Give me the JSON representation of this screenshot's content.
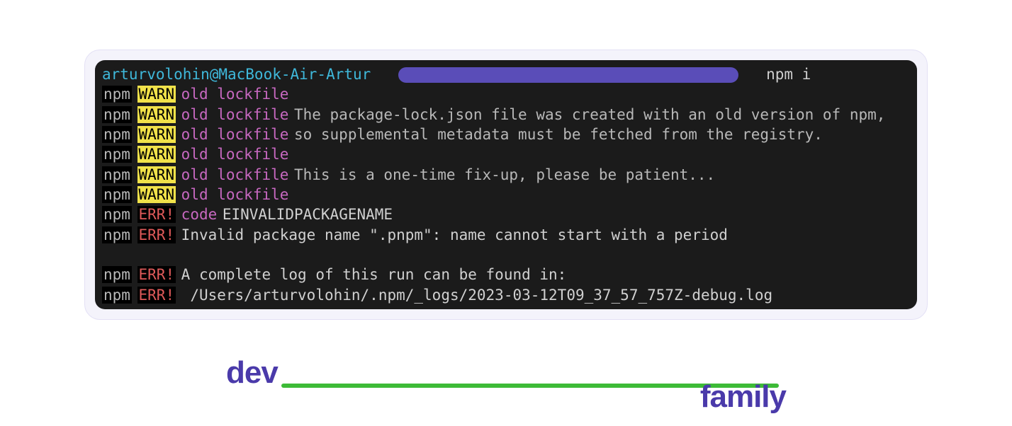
{
  "colors": {
    "terminal_bg": "#1b1b1b",
    "frame_bg": "#f4f3fb",
    "warn_bg": "#f1e24a",
    "err_fg": "#e05a5a",
    "category_fg": "#c768c0",
    "user_host_fg": "#3fb8da",
    "pill_bg": "#5a4db8",
    "logo_fg": "#4a3aaa",
    "logo_line": "#3dbb37"
  },
  "prompt": {
    "user_host": "arturvolohin@MacBook-Air-Artur",
    "path_redacted": true,
    "command": "npm i"
  },
  "npm_prefix": "npm",
  "badges": {
    "warn": "WARN",
    "err": "ERR!"
  },
  "categories": {
    "old_lockfile": "old lockfile",
    "code": "code"
  },
  "warn_lines": [
    {
      "message": ""
    },
    {
      "message": "The package-lock.json file was created with an old version of npm,"
    },
    {
      "message": "so supplemental metadata must be fetched from the registry."
    },
    {
      "message": ""
    },
    {
      "message": "This is a one-time fix-up, please be patient..."
    },
    {
      "message": ""
    }
  ],
  "err_lines": [
    {
      "category": "code",
      "message": "EINVALIDPACKAGENAME"
    },
    {
      "category": null,
      "message": "Invalid package name \".pnpm\": name cannot start with a period"
    }
  ],
  "err_footer": [
    {
      "message": "A complete log of this run can be found in:"
    },
    {
      "message": "    /Users/arturvolohin/.npm/_logs/2023-03-12T09_37_57_757Z-debug.log"
    }
  ],
  "logo": {
    "left_word": "dev",
    "right_word": "family"
  }
}
